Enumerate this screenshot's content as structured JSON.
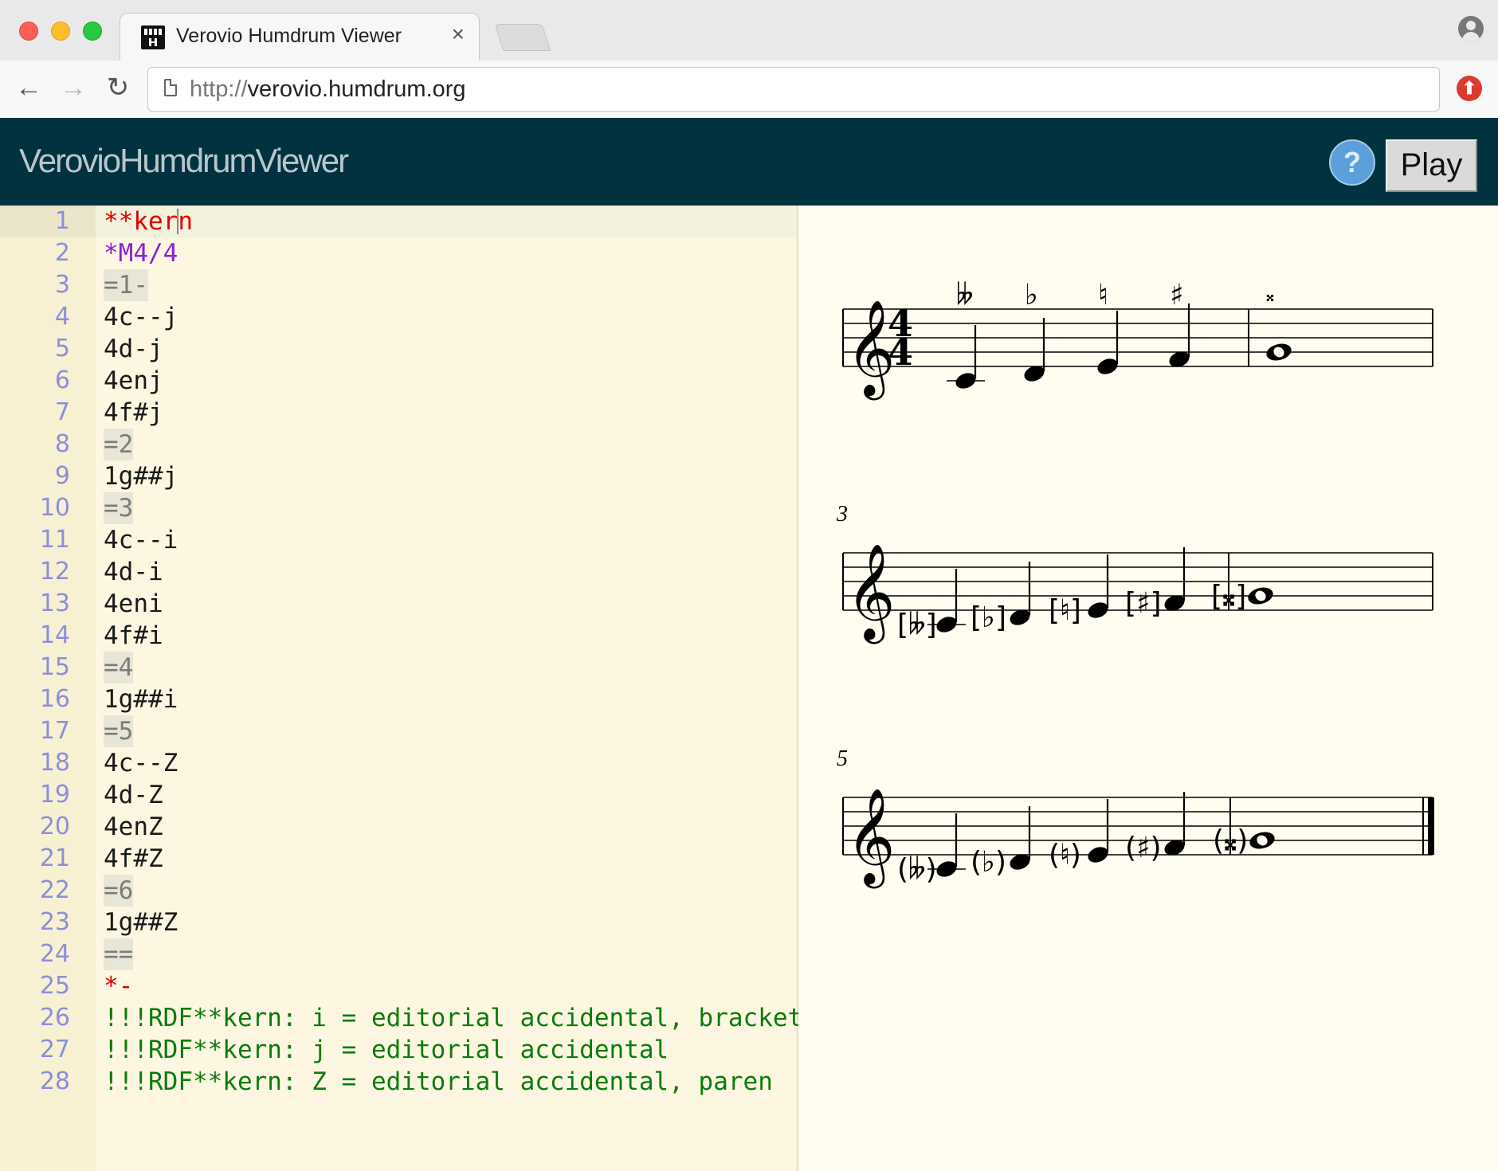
{
  "browser": {
    "tab_title": "Verovio Humdrum Viewer",
    "tab_close": "×",
    "url_scheme": "http://",
    "url_host": "verovio.humdrum.org",
    "back": "←",
    "forward": "→",
    "reload": "↻"
  },
  "app": {
    "title": "VerovioHumdrumViewer",
    "help_label": "?",
    "play_label": "Play",
    "header_color": "#003240"
  },
  "editor": {
    "lines": [
      {
        "n": "1",
        "text": "**kern",
        "style": "red"
      },
      {
        "n": "2",
        "text": "*M4/4",
        "style": "purple"
      },
      {
        "n": "3",
        "text": "=1-",
        "style": "bar"
      },
      {
        "n": "4",
        "text": "4c--j",
        "style": "plain"
      },
      {
        "n": "5",
        "text": "4d-j",
        "style": "plain"
      },
      {
        "n": "6",
        "text": "4enj",
        "style": "plain"
      },
      {
        "n": "7",
        "text": "4f#j",
        "style": "plain"
      },
      {
        "n": "8",
        "text": "=2",
        "style": "bar"
      },
      {
        "n": "9",
        "text": "1g##j",
        "style": "plain"
      },
      {
        "n": "10",
        "text": "=3",
        "style": "bar"
      },
      {
        "n": "11",
        "text": "4c--i",
        "style": "plain"
      },
      {
        "n": "12",
        "text": "4d-i",
        "style": "plain"
      },
      {
        "n": "13",
        "text": "4eni",
        "style": "plain"
      },
      {
        "n": "14",
        "text": "4f#i",
        "style": "plain"
      },
      {
        "n": "15",
        "text": "=4",
        "style": "bar"
      },
      {
        "n": "16",
        "text": "1g##i",
        "style": "plain"
      },
      {
        "n": "17",
        "text": "=5",
        "style": "bar"
      },
      {
        "n": "18",
        "text": "4c--Z",
        "style": "plain"
      },
      {
        "n": "19",
        "text": "4d-Z",
        "style": "plain"
      },
      {
        "n": "20",
        "text": "4enZ",
        "style": "plain"
      },
      {
        "n": "21",
        "text": "4f#Z",
        "style": "plain"
      },
      {
        "n": "22",
        "text": "=6",
        "style": "bar"
      },
      {
        "n": "23",
        "text": "1g##Z",
        "style": "plain"
      },
      {
        "n": "24",
        "text": "==",
        "style": "bar"
      },
      {
        "n": "25",
        "text": "*-",
        "style": "red"
      },
      {
        "n": "26",
        "text": "!!!RDF**kern: i = editorial accidental, bracket",
        "style": "green"
      },
      {
        "n": "27",
        "text": "!!!RDF**kern: j = editorial accidental",
        "style": "green"
      },
      {
        "n": "28",
        "text": "!!!RDF**kern: Z = editorial accidental, paren",
        "style": "green"
      }
    ]
  },
  "score": {
    "systems": [
      {
        "measure_number": "",
        "time_signature": [
          "4",
          "4"
        ],
        "accidental_style": "above",
        "notes": [
          {
            "acc": "double-flat",
            "pitch": "C4",
            "duration": "quarter"
          },
          {
            "acc": "flat",
            "pitch": "D4",
            "duration": "quarter"
          },
          {
            "acc": "natural",
            "pitch": "E4",
            "duration": "quarter"
          },
          {
            "acc": "sharp",
            "pitch": "F4",
            "duration": "quarter"
          },
          {
            "acc": "double-sharp",
            "pitch": "G4",
            "duration": "whole"
          }
        ]
      },
      {
        "measure_number": "3",
        "accidental_style": "bracket",
        "notes": [
          {
            "acc": "double-flat",
            "pitch": "C4",
            "duration": "quarter"
          },
          {
            "acc": "flat",
            "pitch": "D4",
            "duration": "quarter"
          },
          {
            "acc": "natural",
            "pitch": "E4",
            "duration": "quarter"
          },
          {
            "acc": "sharp",
            "pitch": "F4",
            "duration": "quarter"
          },
          {
            "acc": "double-sharp",
            "pitch": "G4",
            "duration": "whole"
          }
        ]
      },
      {
        "measure_number": "5",
        "accidental_style": "paren",
        "notes": [
          {
            "acc": "double-flat",
            "pitch": "C4",
            "duration": "quarter"
          },
          {
            "acc": "flat",
            "pitch": "D4",
            "duration": "quarter"
          },
          {
            "acc": "natural",
            "pitch": "E4",
            "duration": "quarter"
          },
          {
            "acc": "sharp",
            "pitch": "F4",
            "duration": "quarter"
          },
          {
            "acc": "double-sharp",
            "pitch": "G4",
            "duration": "whole"
          }
        ]
      }
    ]
  }
}
